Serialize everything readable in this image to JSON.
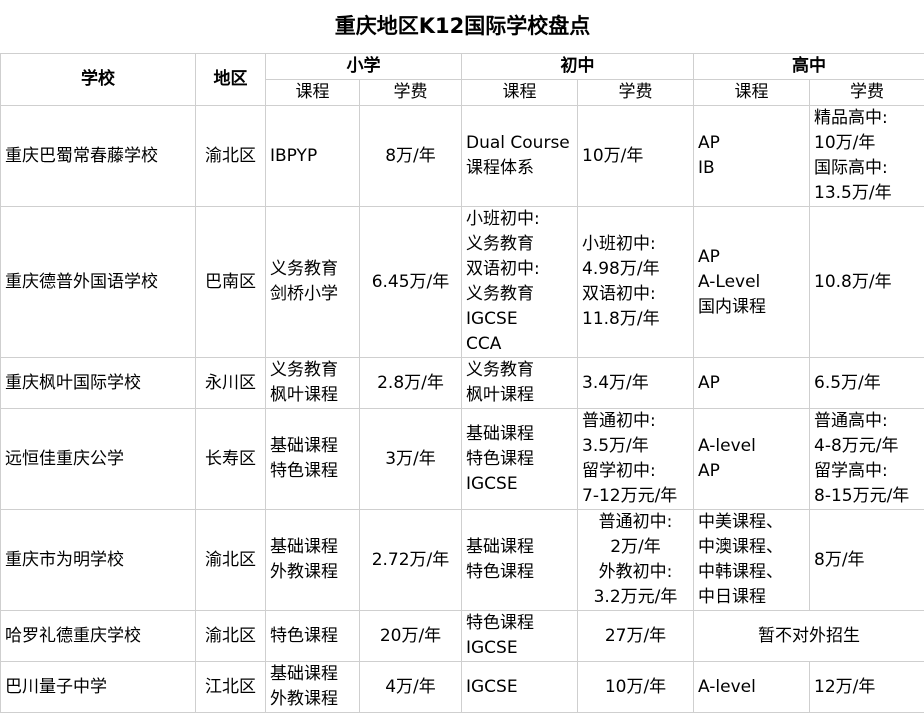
{
  "title": "重庆地区K12国际学校盘点",
  "header": {
    "school": "学校",
    "region": "地区",
    "primary": "小学",
    "middle": "初中",
    "high": "高中",
    "course": "课程",
    "fee": "学费"
  },
  "rows": [
    {
      "school": "重庆巴蜀常春藤学校",
      "region": "渝北区",
      "p_course": [
        "IBPYP"
      ],
      "p_fee": [
        "8万/年"
      ],
      "m_course": [
        "Dual Course",
        "课程体系"
      ],
      "m_fee": [
        "10万/年"
      ],
      "h_course": [
        "AP",
        "IB"
      ],
      "h_fee": [
        "精品高中:",
        "10万/年",
        "国际高中:",
        "13.5万/年"
      ]
    },
    {
      "school": "重庆德普外国语学校",
      "region": "巴南区",
      "p_course": [
        "义务教育",
        "剑桥小学"
      ],
      "p_fee": [
        "6.45万/年"
      ],
      "m_course": [
        "小班初中:",
        "义务教育",
        "双语初中:",
        "义务教育",
        "IGCSE",
        "CCA"
      ],
      "m_fee": [
        "小班初中:",
        "4.98万/年",
        "双语初中:",
        "11.8万/年"
      ],
      "h_course": [
        "AP",
        "A-Level",
        "国内课程"
      ],
      "h_fee": [
        "10.8万/年"
      ]
    },
    {
      "school": "重庆枫叶国际学校",
      "region": "永川区",
      "p_course": [
        "义务教育",
        "枫叶课程"
      ],
      "p_fee": [
        "2.8万/年"
      ],
      "m_course": [
        "义务教育",
        "枫叶课程"
      ],
      "m_fee": [
        "3.4万/年"
      ],
      "h_course": [
        "AP"
      ],
      "h_fee": [
        "6.5万/年"
      ]
    },
    {
      "school": "远恒佳重庆公学",
      "region": "长寿区",
      "p_course": [
        "基础课程",
        "特色课程"
      ],
      "p_fee": [
        "3万/年"
      ],
      "m_course": [
        "基础课程",
        "特色课程",
        "IGCSE"
      ],
      "m_fee": [
        "普通初中:",
        "3.5万/年",
        "留学初中:",
        "7-12万元/年"
      ],
      "h_course": [
        "A-level",
        "AP"
      ],
      "h_fee": [
        "普通高中:",
        "4-8万元/年",
        "留学高中:",
        "8-15万元/年"
      ]
    },
    {
      "school": "重庆市为明学校",
      "region": "渝北区",
      "p_course": [
        "基础课程",
        "外教课程"
      ],
      "p_fee": [
        "2.72万/年"
      ],
      "m_course": [
        "基础课程",
        "特色课程"
      ],
      "m_fee": [
        "普通初中:",
        "2万/年",
        "外教初中:",
        "3.2万元/年"
      ],
      "h_course": [
        "中美课程、",
        "中澳课程、",
        "中韩课程、",
        "中日课程"
      ],
      "h_fee": [
        "8万/年"
      ]
    },
    {
      "school": "哈罗礼德重庆学校",
      "region": "渝北区",
      "p_course": [
        "特色课程"
      ],
      "p_fee": [
        "20万/年"
      ],
      "m_course": [
        "特色课程",
        "IGCSE"
      ],
      "m_fee": [
        "27万/年"
      ],
      "h_merged": "暂不对外招生"
    },
    {
      "school": "巴川量子中学",
      "region": "江北区",
      "p_course": [
        "基础课程",
        "外教课程"
      ],
      "p_fee": [
        "4万/年"
      ],
      "m_course": [
        "IGCSE"
      ],
      "m_fee": [
        "10万/年"
      ],
      "h_course": [
        "A-level"
      ],
      "h_fee": [
        "12万/年"
      ]
    }
  ]
}
